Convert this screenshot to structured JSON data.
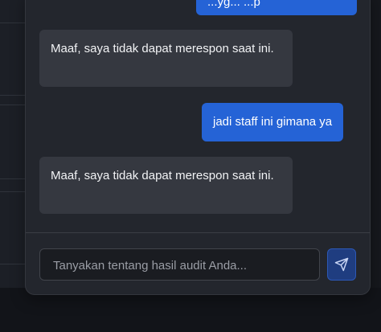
{
  "chat": {
    "messages": [
      {
        "role": "user",
        "text": "...yg... ...p"
      },
      {
        "role": "bot",
        "text": "Maaf, saya tidak dapat merespon saat ini."
      },
      {
        "role": "user",
        "text": "jadi staff ini gimana ya"
      },
      {
        "role": "bot",
        "text": "Maaf, saya tidak dapat merespon saat ini."
      }
    ],
    "input": {
      "placeholder": "Tanyakan tentang hasil audit Anda...",
      "value": ""
    },
    "send_icon": "send-icon"
  },
  "colors": {
    "user_bubble": "#2563d6",
    "bot_bubble": "#353840",
    "panel": "#23262d",
    "send_button": "#1f3d80"
  }
}
